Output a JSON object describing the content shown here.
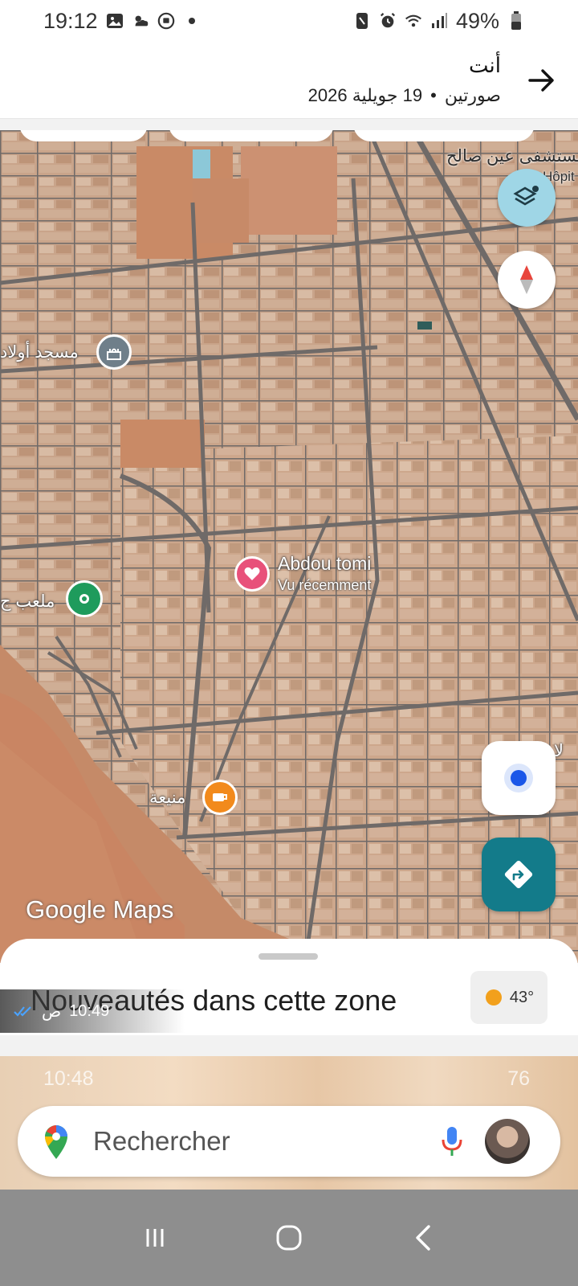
{
  "status_bar": {
    "time": "19:12",
    "battery": "49%",
    "icons": [
      "gallery-icon",
      "weather-icon",
      "messenger-icon",
      "dot-icon",
      "nfc-icon",
      "alarm-icon",
      "wifi-icon",
      "signal-icon",
      "battery-icon"
    ]
  },
  "viewer_header": {
    "title": "أنت",
    "subtitle_kind": "صورتين",
    "subtitle_separator": "•",
    "subtitle_date": "19 جويلية 2026"
  },
  "map": {
    "labels": {
      "hospital": "مستشفى عين صالح",
      "hospital_sub": "Hôpit",
      "mosque": "مسجد أولاد",
      "stadium": "ملعب ج",
      "mnia": "منيعة",
      "right_edge": "لا",
      "saved_place_name": "Abdou tomi",
      "saved_place_sub": "Vu récemment"
    },
    "logo": "Google Maps",
    "colors": {
      "terrain": "#c58a68",
      "roads": "#7a7471",
      "layers_button": "#9fd6e6",
      "directions_button": "#137b8a",
      "saved_pin": "#e8517a",
      "park_pin": "#1e9b5c",
      "cafe_pin": "#f28a1c",
      "poi_pin": "#6f7f8a"
    }
  },
  "sheet": {
    "title": "Nouveautés dans cette zone",
    "weather_temp": "43°"
  },
  "message_overlay": {
    "time": "10:49",
    "suffix": "ص"
  },
  "lower": {
    "faint_time": "10:48",
    "faint_battery": "76",
    "search_placeholder": "Rechercher"
  }
}
